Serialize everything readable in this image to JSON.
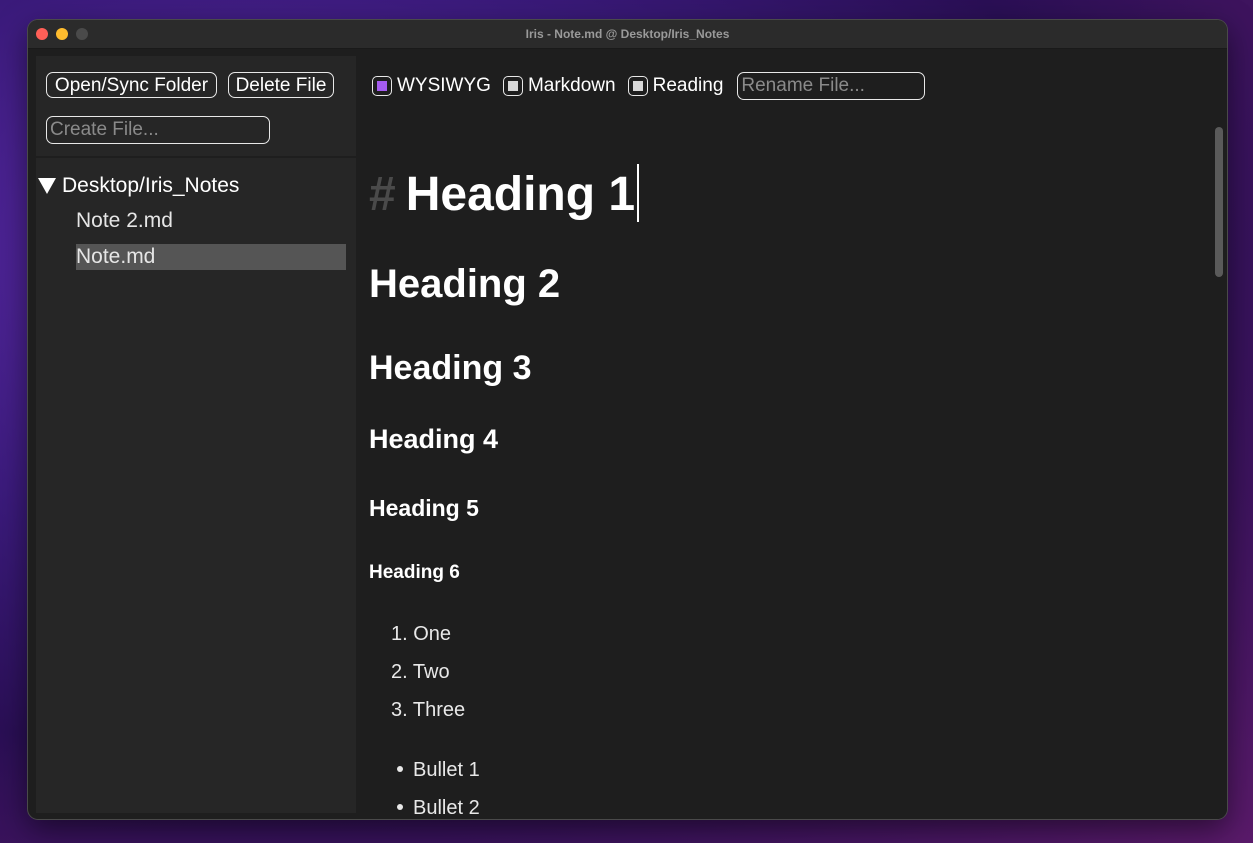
{
  "window": {
    "title": "Iris - Note.md @ Desktop/Iris_Notes"
  },
  "sidebar": {
    "open_sync_label": "Open/Sync Folder",
    "delete_label": "Delete File",
    "create_placeholder": "Create File...",
    "folder_name": "Desktop/Iris_Notes",
    "files": [
      "Note 2.md",
      "Note.md"
    ],
    "selected_file": "Note.md"
  },
  "toolbar": {
    "modes": [
      {
        "label": "WYSIWYG",
        "checked": true
      },
      {
        "label": "Markdown",
        "checked": false
      },
      {
        "label": "Reading",
        "checked": false
      }
    ],
    "rename_placeholder": "Rename File..."
  },
  "editor": {
    "h1_marker": "#",
    "headings": [
      "Heading 1",
      "Heading 2",
      "Heading 3",
      "Heading 4",
      "Heading 5",
      "Heading 6"
    ],
    "ordered_markers": [
      "1.",
      "2.",
      "3."
    ],
    "ordered_items": [
      "One",
      "Two",
      "Three"
    ],
    "bullet_items": [
      "Bullet 1",
      "Bullet 2"
    ]
  },
  "colors": {
    "accent": "#a55cf0",
    "unchecked_fill": "#d8d8d8",
    "selected_row": "#555555",
    "editor_bg": "#1e1e1e",
    "sidebar_bg": "#262626"
  }
}
